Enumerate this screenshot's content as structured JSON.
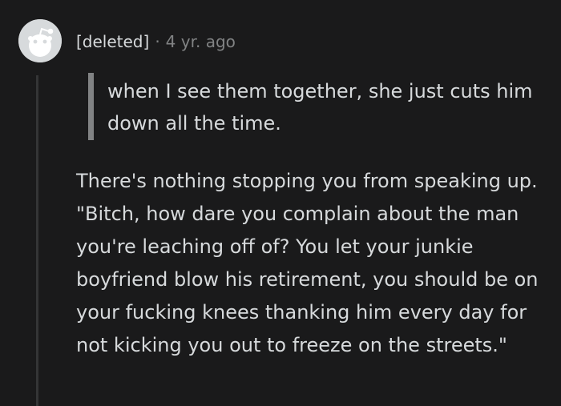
{
  "comment": {
    "author": "[deleted]",
    "separator": "·",
    "timestamp": "4 yr. ago",
    "avatar_icon": "reddit-snoo-icon",
    "quote": "when I see them together, she just cuts him down all the time.",
    "body": "There's nothing stopping you from speaking up. \"Bitch, how dare you complain about the man you're leaching off of? You let your junkie boyfriend blow his retirement, you should be on your fucking knees thanking him every day for not kicking you out to freeze on the streets.\""
  },
  "colors": {
    "background": "#1a1a1b",
    "text": "#d7dadc",
    "muted": "#818384",
    "thread_line": "#343536"
  }
}
